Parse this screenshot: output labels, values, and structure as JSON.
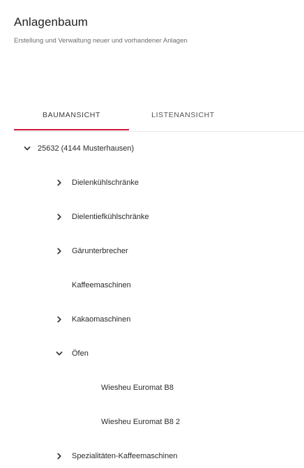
{
  "header": {
    "title": "Anlagenbaum",
    "subtitle": "Erstellung und Verwaltung neuer und vorhandener Anlagen"
  },
  "tabs": [
    {
      "label": "BAUMANSICHT",
      "active": true
    },
    {
      "label": "LISTENANSICHT",
      "active": false
    }
  ],
  "colors": {
    "accent": "#d6143a"
  },
  "tree": {
    "root": {
      "label": "25632 (4144 Musterhausen)",
      "icon": "chevron-down-icon"
    },
    "items": [
      {
        "label": "Dielenkühlschränke",
        "icon": "chevron-right-icon"
      },
      {
        "label": "Dielentiefkühlschränke",
        "icon": "chevron-right-icon"
      },
      {
        "label": "Gärunterbrecher",
        "icon": "chevron-right-icon"
      },
      {
        "label": "Kaffeemaschinen",
        "icon": ""
      },
      {
        "label": "Kakaomaschinen",
        "icon": "chevron-right-icon"
      },
      {
        "label": "Öfen",
        "icon": "chevron-down-icon"
      },
      {
        "label": "Wiesheu Euromat B8",
        "icon": ""
      },
      {
        "label": "Wiesheu Euromat B8 2",
        "icon": ""
      },
      {
        "label": "Spezialitäten-Kaffeemaschinen",
        "icon": "chevron-right-icon"
      }
    ]
  }
}
